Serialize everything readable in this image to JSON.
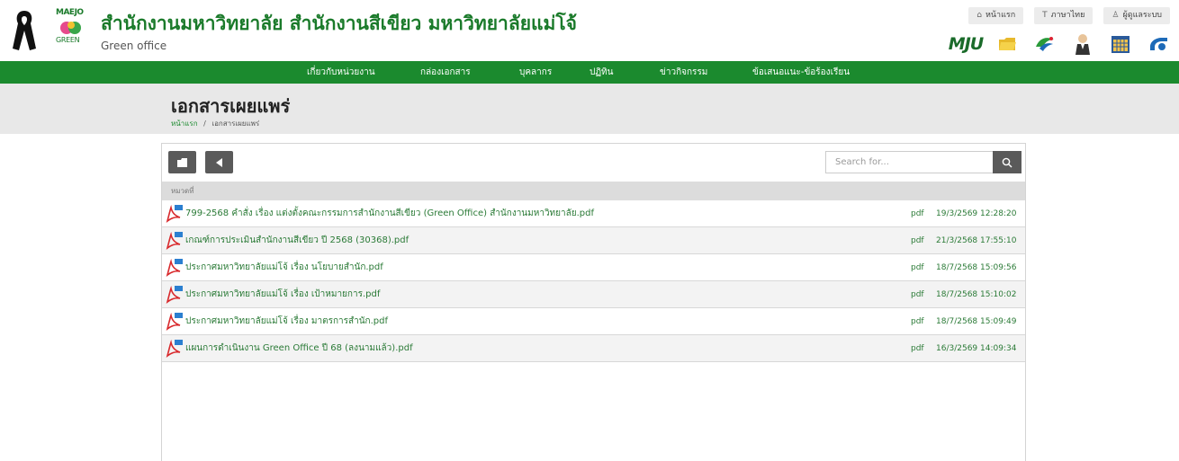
{
  "header": {
    "site_title": "สำนักงานมหาวิทยาลัย สำนักงานสีเขียว มหาวิทยาลัยแม่โจ้",
    "site_subtitle": "Green office",
    "logo_text": "MAEJO",
    "logo_sub": "GREEN",
    "top_links": [
      {
        "label": "หน้าแรก",
        "icon": "home-icon"
      },
      {
        "label": "ภาษาไทย",
        "icon": "text-icon"
      },
      {
        "label": "ผู้ดูแลระบบ",
        "icon": "user-icon"
      }
    ],
    "top_icons": [
      {
        "label": "MJU",
        "icon": "mju-logo"
      },
      {
        "icon": "folder-icon"
      },
      {
        "icon": "bird-icon"
      },
      {
        "icon": "person-icon"
      },
      {
        "icon": "calendar-icon"
      },
      {
        "icon": "phone-icon"
      }
    ]
  },
  "nav": {
    "items": [
      {
        "label": "เกี่ยวกับหน่วยงาน"
      },
      {
        "label": "กล่องเอกสาร"
      },
      {
        "label": "บุคลากร"
      },
      {
        "label": "ปฏิทิน"
      },
      {
        "label": "ข่าวกิจกรรม"
      },
      {
        "label": "ข้อเสนอแนะ-ข้อร้องเรียน"
      }
    ]
  },
  "page": {
    "title": "เอกสารเผยแพร่",
    "breadcrumb_home": "หน้าแรก",
    "breadcrumb_sep": "/",
    "breadcrumb_current": "เอกสารเผยแพร่"
  },
  "browser": {
    "search_placeholder": "Search for...",
    "column_header": "หมวดที่",
    "files": [
      {
        "name": "799-2568 คำสั่ง เรื่อง แต่งตั้งคณะกรรมการสำนักงานสีเขียว (Green Office) สำนักงานมหาวิทยาลัย.pdf",
        "type": "pdf",
        "date": "19/3/2569 12:28:20"
      },
      {
        "name": "เกณฑ์การประเมินสำนักงานสีเขียว ปี 2568 (30368).pdf",
        "type": "pdf",
        "date": "21/3/2568 17:55:10"
      },
      {
        "name": "ประกาศมหาวิทยาลัยแม่โจ้ เรื่อง นโยบายสำนัก.pdf",
        "type": "pdf",
        "date": "18/7/2568 15:09:56"
      },
      {
        "name": "ประกาศมหาวิทยาลัยแม่โจ้ เรื่อง เป้าหมายการ.pdf",
        "type": "pdf",
        "date": "18/7/2568 15:10:02"
      },
      {
        "name": "ประกาศมหาวิทยาลัยแม่โจ้ เรื่อง มาตรการสำนัก.pdf",
        "type": "pdf",
        "date": "18/7/2568 15:09:49"
      },
      {
        "name": "แผนการดำเนินงาน Green Office ปี 68 (ลงนามแล้ว).pdf",
        "type": "pdf",
        "date": "16/3/2569 14:09:34"
      }
    ]
  }
}
